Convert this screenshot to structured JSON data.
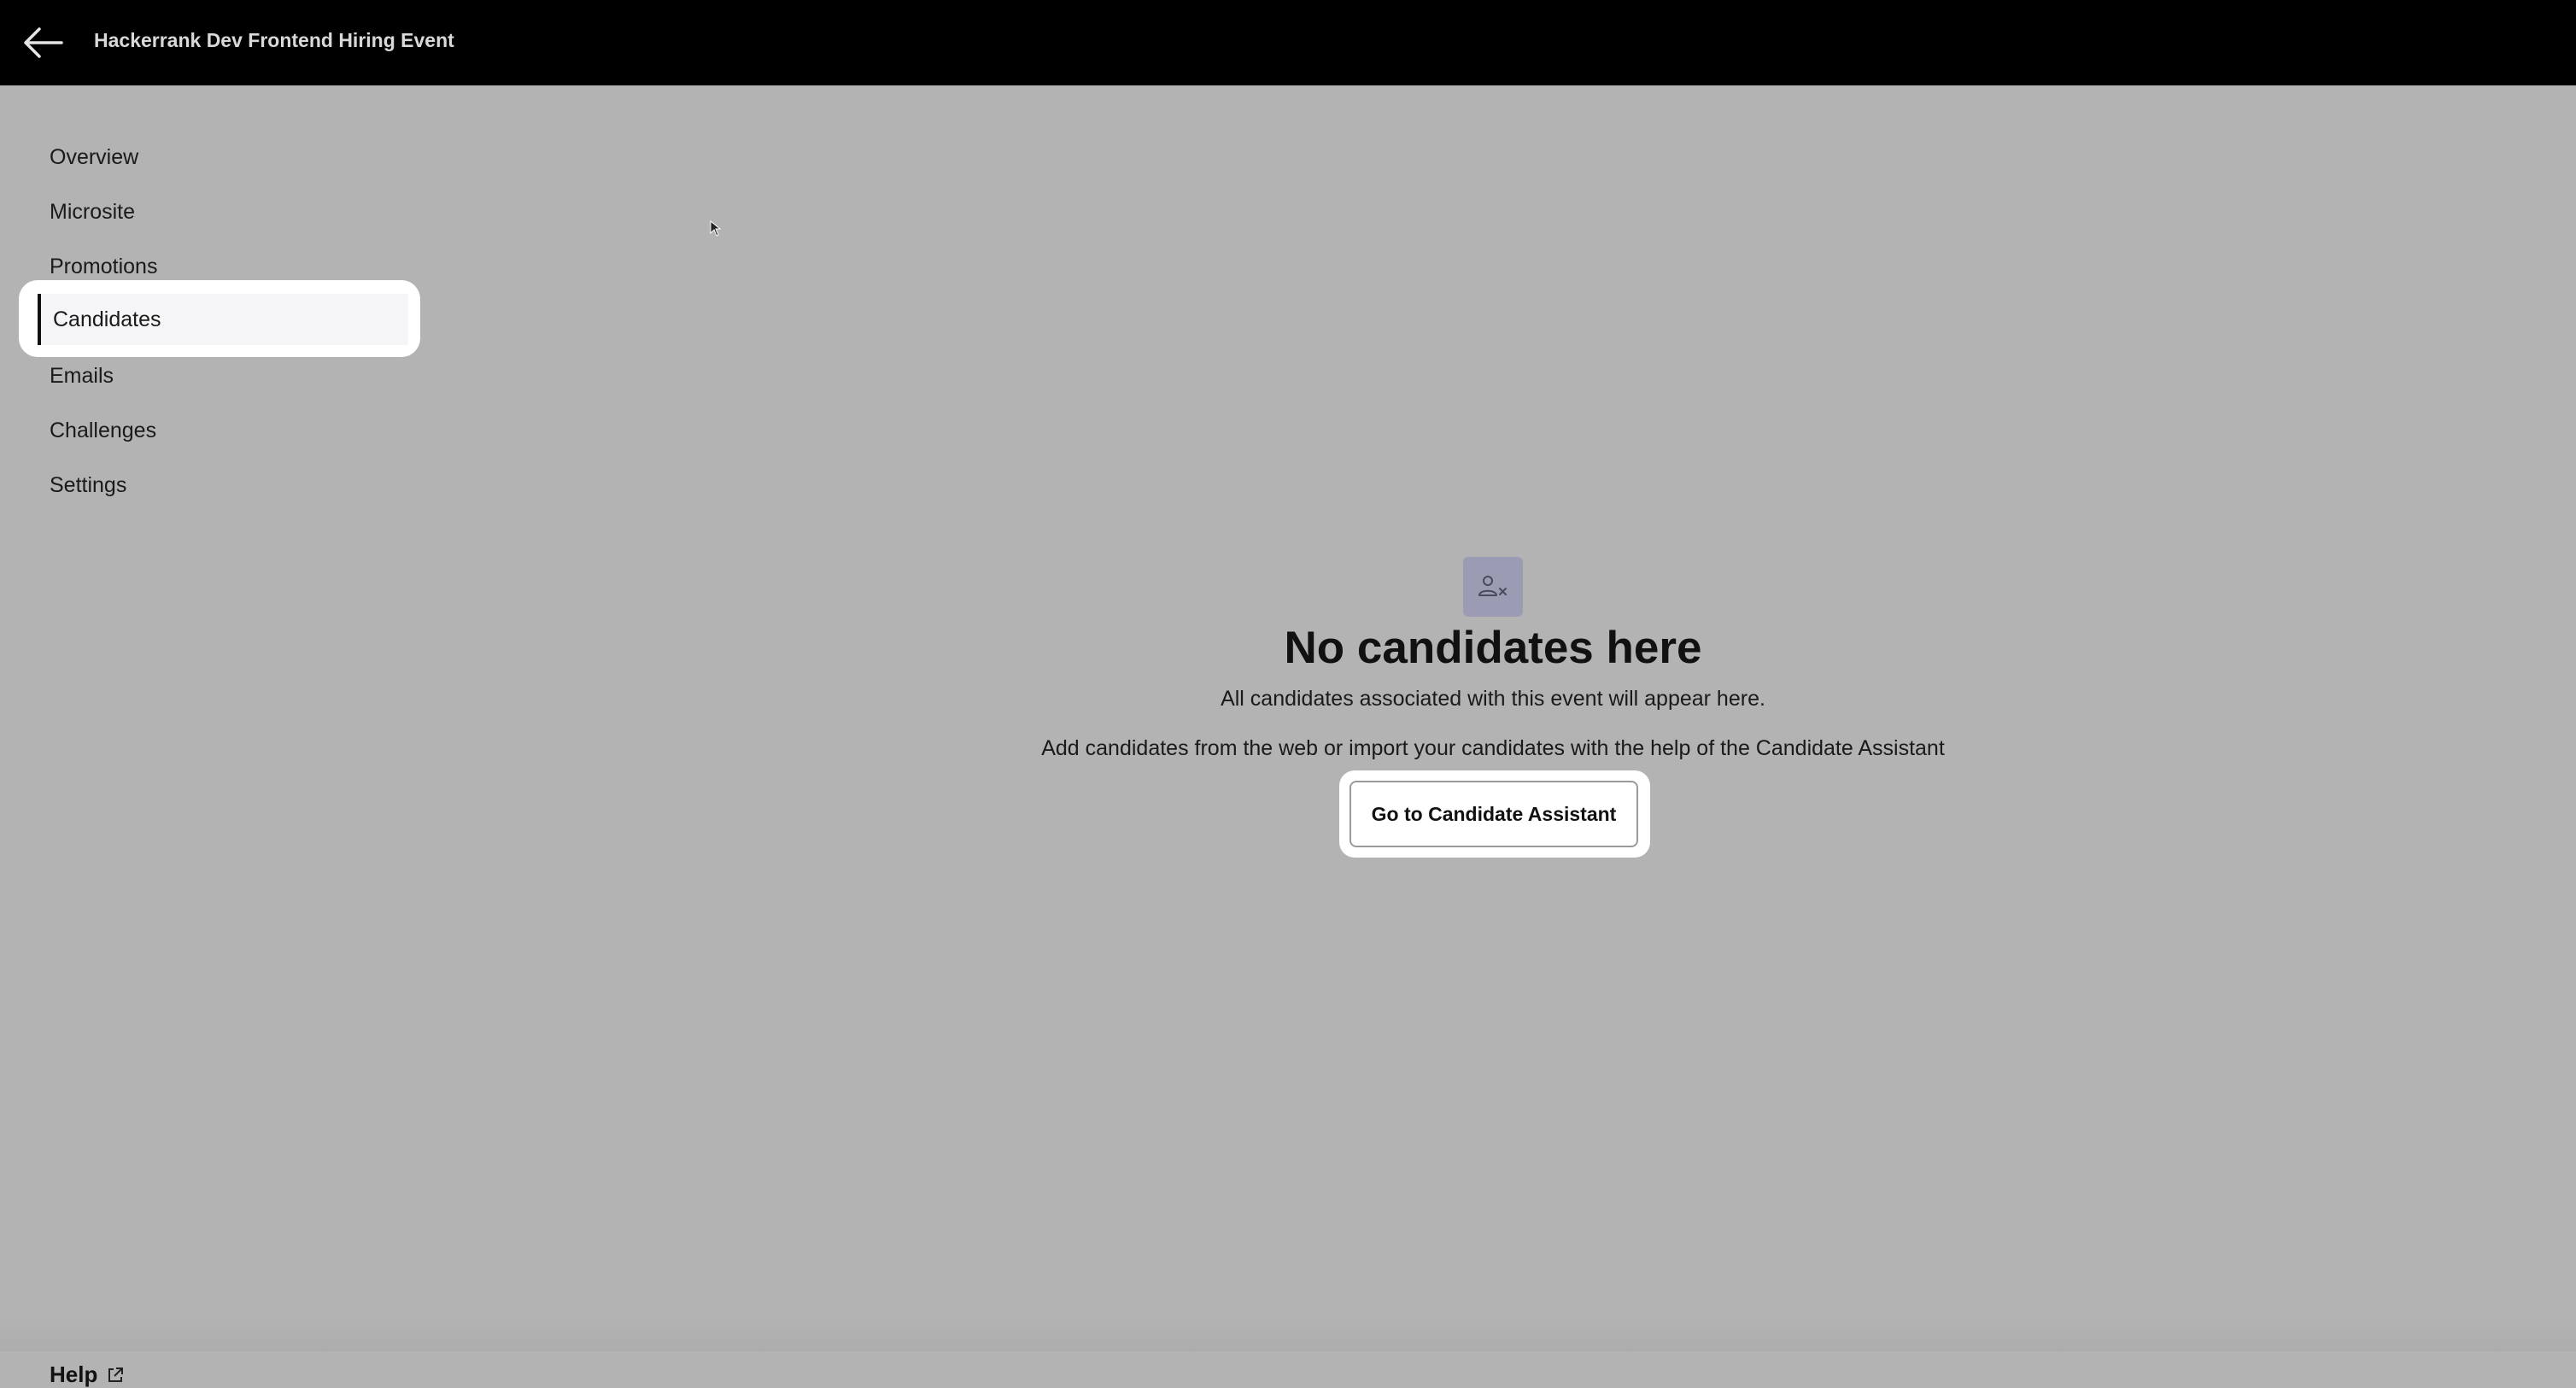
{
  "topbar": {
    "back_icon": "arrow-left-icon",
    "title": "Hackerrank Dev Frontend Hiring Event"
  },
  "sidebar": {
    "items": [
      {
        "label": "Overview"
      },
      {
        "label": "Microsite"
      },
      {
        "label": "Promotions"
      },
      {
        "label": "Candidates",
        "active": true
      },
      {
        "label": "Emails"
      },
      {
        "label": "Challenges"
      },
      {
        "label": "Settings"
      }
    ],
    "help": {
      "label": "Help",
      "icon": "external-link-icon"
    }
  },
  "empty_state": {
    "icon": "user-x-icon",
    "icon_color": "#9b9cb3",
    "title": "No candidates here",
    "subtitle": "All candidates associated with this event will appear here.",
    "description": "Add candidates from the web or import your candidates with the help of the Candidate Assistant",
    "cta_label": "Go to Candidate Assistant"
  },
  "colors": {
    "topbar_bg": "#000000",
    "overlay_bg": "#b3b3b3",
    "highlight": "#ffffff"
  }
}
